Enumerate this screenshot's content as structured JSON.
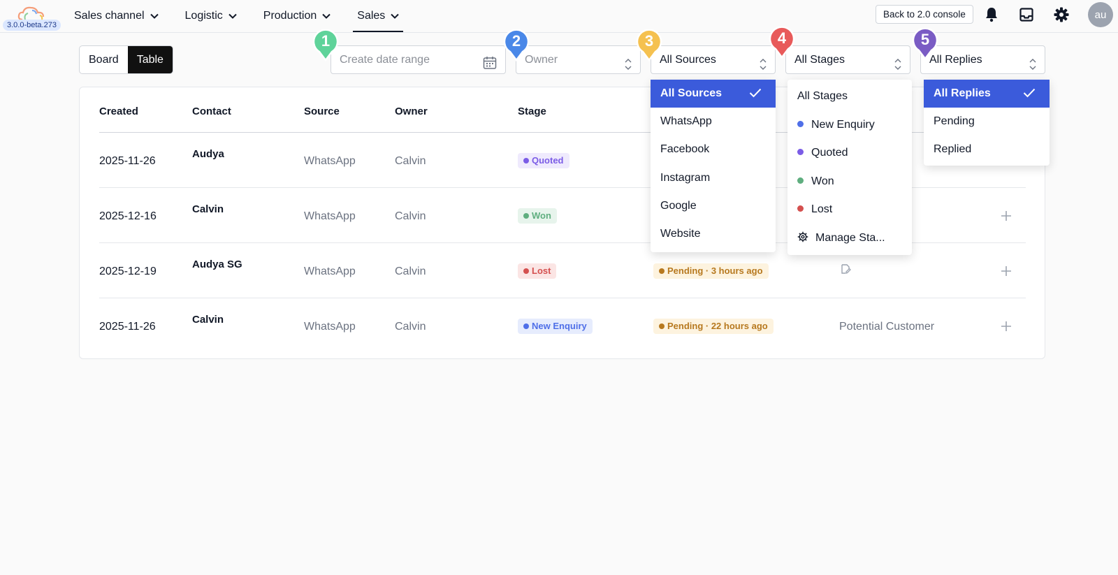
{
  "app": {
    "version": "3.0.0-beta.273",
    "nav": [
      {
        "label": "Sales channel",
        "active": false
      },
      {
        "label": "Logistic",
        "active": false
      },
      {
        "label": "Production",
        "active": false
      },
      {
        "label": "Sales",
        "active": true
      }
    ],
    "back_label": "Back to 2.0 console",
    "avatar": "au"
  },
  "toolbar": {
    "board_label": "Board",
    "table_label": "Table",
    "active_view": "Table",
    "date_placeholder": "Create date range",
    "owner_placeholder": "Owner",
    "sources_value": "All Sources",
    "stages_value": "All Stages",
    "replies_value": "All Replies"
  },
  "markers": [
    {
      "n": "1",
      "color": "#5fd39a"
    },
    {
      "n": "2",
      "color": "#4a88e8"
    },
    {
      "n": "3",
      "color": "#f5c150"
    },
    {
      "n": "4",
      "color": "#e85a5a"
    },
    {
      "n": "5",
      "color": "#7a5cc4"
    }
  ],
  "table": {
    "headers": [
      "Created",
      "Contact",
      "Source",
      "Owner",
      "Stage"
    ],
    "rows": [
      {
        "created": "2025-11-26",
        "contact": "Audya",
        "source": "WhatsApp",
        "owner": "Calvin",
        "stage": "Quoted",
        "reply": "",
        "note": ""
      },
      {
        "created": "2025-12-16",
        "contact": "Calvin",
        "source": "WhatsApp",
        "owner": "Calvin",
        "stage": "Won",
        "reply": "",
        "note": ""
      },
      {
        "created": "2025-12-19",
        "contact": "Audya SG",
        "source": "WhatsApp",
        "owner": "Calvin",
        "stage": "Lost",
        "reply": "Pending · 3 hours ago",
        "note": ""
      },
      {
        "created": "2025-11-26",
        "contact": "Calvin",
        "source": "WhatsApp",
        "owner": "Calvin",
        "stage": "New Enquiry",
        "reply": "Pending · 22 hours ago",
        "note": "Potential Customer"
      }
    ]
  },
  "sources_menu": {
    "options": [
      "All Sources",
      "WhatsApp",
      "Facebook",
      "Instagram",
      "Google",
      "Website"
    ],
    "selected": "All Sources"
  },
  "stages_menu": {
    "all_label": "All Stages",
    "options": [
      {
        "label": "New Enquiry",
        "color": "#4f6fe8"
      },
      {
        "label": "Quoted",
        "color": "#7b5ce6"
      },
      {
        "label": "Won",
        "color": "#5fae7f"
      },
      {
        "label": "Lost",
        "color": "#d4504f"
      }
    ],
    "manage_label": "Manage Sta..."
  },
  "replies_menu": {
    "options": [
      "All Replies",
      "Pending",
      "Replied"
    ],
    "selected": "All Replies"
  },
  "colors": {
    "quoted_bg": "#efeafd",
    "quoted_fg": "#7b5ce6",
    "won_bg": "#e7f4ec",
    "won_fg": "#5fae7f",
    "lost_bg": "#fbe5e4",
    "lost_fg": "#d4504f",
    "enquiry_bg": "#e6ecfd",
    "enquiry_fg": "#4f6fe8",
    "pending_bg": "#fdf3df",
    "pending_fg": "#b7791f",
    "selected_bg": "#3b5bdb"
  }
}
